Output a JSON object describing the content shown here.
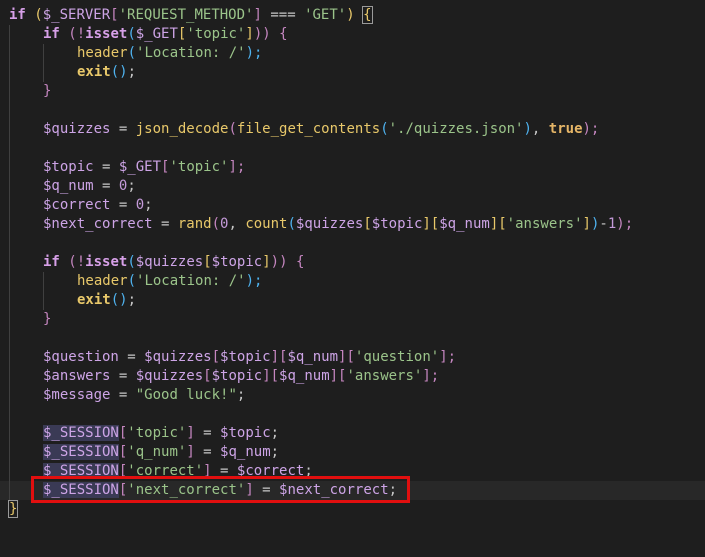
{
  "editor": {
    "lines": [
      {
        "text_html": "if",
        "i": 0
      },
      {
        "text_html": "",
        "i": 1
      }
    ],
    "code": {
      "l1_kw": "if",
      "l1_open": "(",
      "l1_var": "$_SERVER",
      "l1_br_open": "[",
      "l1_str": "'REQUEST_METHOD'",
      "l1_br_close": "]",
      "l1_op": " === ",
      "l1_str2": "'GET'",
      "l1_close": ")",
      "l1_brace": "{",
      "l2_kw": "if",
      "l2_open": "(",
      "l2_not": "!",
      "l2_fn": "isset",
      "l2_open2": "(",
      "l2_var": "$_GET",
      "l2_br_open": "[",
      "l2_str": "'topic'",
      "l2_br_close": "]",
      "l2_close": "))",
      "l2_brace": "{",
      "l3_fn": "header",
      "l3_open": "(",
      "l3_str": "'Location: /'",
      "l3_close": ");",
      "l4_fn": "exit",
      "l4_paren": "()",
      "l4_semi": ";",
      "l5_brace": "}",
      "l7_var": "$quizzes",
      "l7_op": " = ",
      "l7_fn": "json_decode",
      "l7_open": "(",
      "l7_fn2": "file_get_contents",
      "l7_open2": "(",
      "l7_str": "'./quizzes.json'",
      "l7_close2": ")",
      "l7_comma": ", ",
      "l7_bool": "true",
      "l7_close": ");",
      "l9_var": "$topic",
      "l9_op": " = ",
      "l9_var2": "$_GET",
      "l9_br": "[",
      "l9_str": "'topic'",
      "l9_brc": "];",
      "l10_var": "$q_num",
      "l10_op": " = ",
      "l10_num": "0",
      "l10_semi": ";",
      "l11_var": "$correct",
      "l11_op": " = ",
      "l11_num": "0",
      "l11_semi": ";",
      "l12_var": "$next_correct",
      "l12_op": " = ",
      "l12_fn": "rand",
      "l12_open": "(",
      "l12_num": "0",
      "l12_comma": ", ",
      "l12_fn2": "count",
      "l12_open2": "(",
      "l12_var2": "$quizzes",
      "l12_b1": "[",
      "l12_var3": "$topic",
      "l12_b2": "][",
      "l12_var4": "$q_num",
      "l12_b3": "][",
      "l12_str": "'answers'",
      "l12_b4": "]",
      "l12_close2": ")",
      "l12_minus": "-",
      "l12_num2": "1",
      "l12_close": ");",
      "l14_kw": "if",
      "l14_open": "(",
      "l14_not": "!",
      "l14_fn": "isset",
      "l14_open2": "(",
      "l14_var": "$quizzes",
      "l14_b1": "[",
      "l14_var2": "$topic",
      "l14_b2": "]",
      "l14_close": "))",
      "l14_brace": "{",
      "l15_fn": "header",
      "l15_open": "(",
      "l15_str": "'Location: /'",
      "l15_close": ");",
      "l16_fn": "exit",
      "l16_paren": "()",
      "l16_semi": ";",
      "l17_brace": "}",
      "l19_var": "$question",
      "l19_op": " = ",
      "l19_var2": "$quizzes",
      "l19_b1": "[",
      "l19_var3": "$topic",
      "l19_b2": "][",
      "l19_var4": "$q_num",
      "l19_b3": "][",
      "l19_str": "'question'",
      "l19_b4": "];",
      "l20_var": "$answers",
      "l20_op": " = ",
      "l20_var2": "$quizzes",
      "l20_b1": "[",
      "l20_var3": "$topic",
      "l20_b2": "][",
      "l20_var4": "$q_num",
      "l20_b3": "][",
      "l20_str": "'answers'",
      "l20_b4": "];",
      "l21_var": "$message",
      "l21_op": " = ",
      "l21_str": "\"Good luck!\"",
      "l21_semi": ";",
      "l23_sess": "$_SESSION",
      "l23_b1": "[",
      "l23_str": "'topic'",
      "l23_b2": "]",
      "l23_op": " = ",
      "l23_var": "$topic",
      "l23_semi": ";",
      "l24_sess": "$_SESSION",
      "l24_b1": "[",
      "l24_str": "'q_num'",
      "l24_b2": "]",
      "l24_op": " = ",
      "l24_var": "$q_num",
      "l24_semi": ";",
      "l25_sess": "$_SESSION",
      "l25_b1": "[",
      "l25_str": "'correct'",
      "l25_b2": "]",
      "l25_op": " = ",
      "l25_var": "$correct",
      "l25_semi": ";",
      "l26_sess": "$_SESSION",
      "l26_b1": "[",
      "l26_str": "'next_correct'",
      "l26_b2": "]",
      "l26_op": " = ",
      "l26_var": "$next_correct",
      "l26_semi": ";",
      "l27_brace": "}"
    },
    "colors": {
      "background": "#1e1e1e",
      "highlight_box": "#e10f0f",
      "keyword": "#c586c0",
      "function": "#e8c86a",
      "string": "#9bc48a",
      "variable": "#cda4e6"
    }
  }
}
